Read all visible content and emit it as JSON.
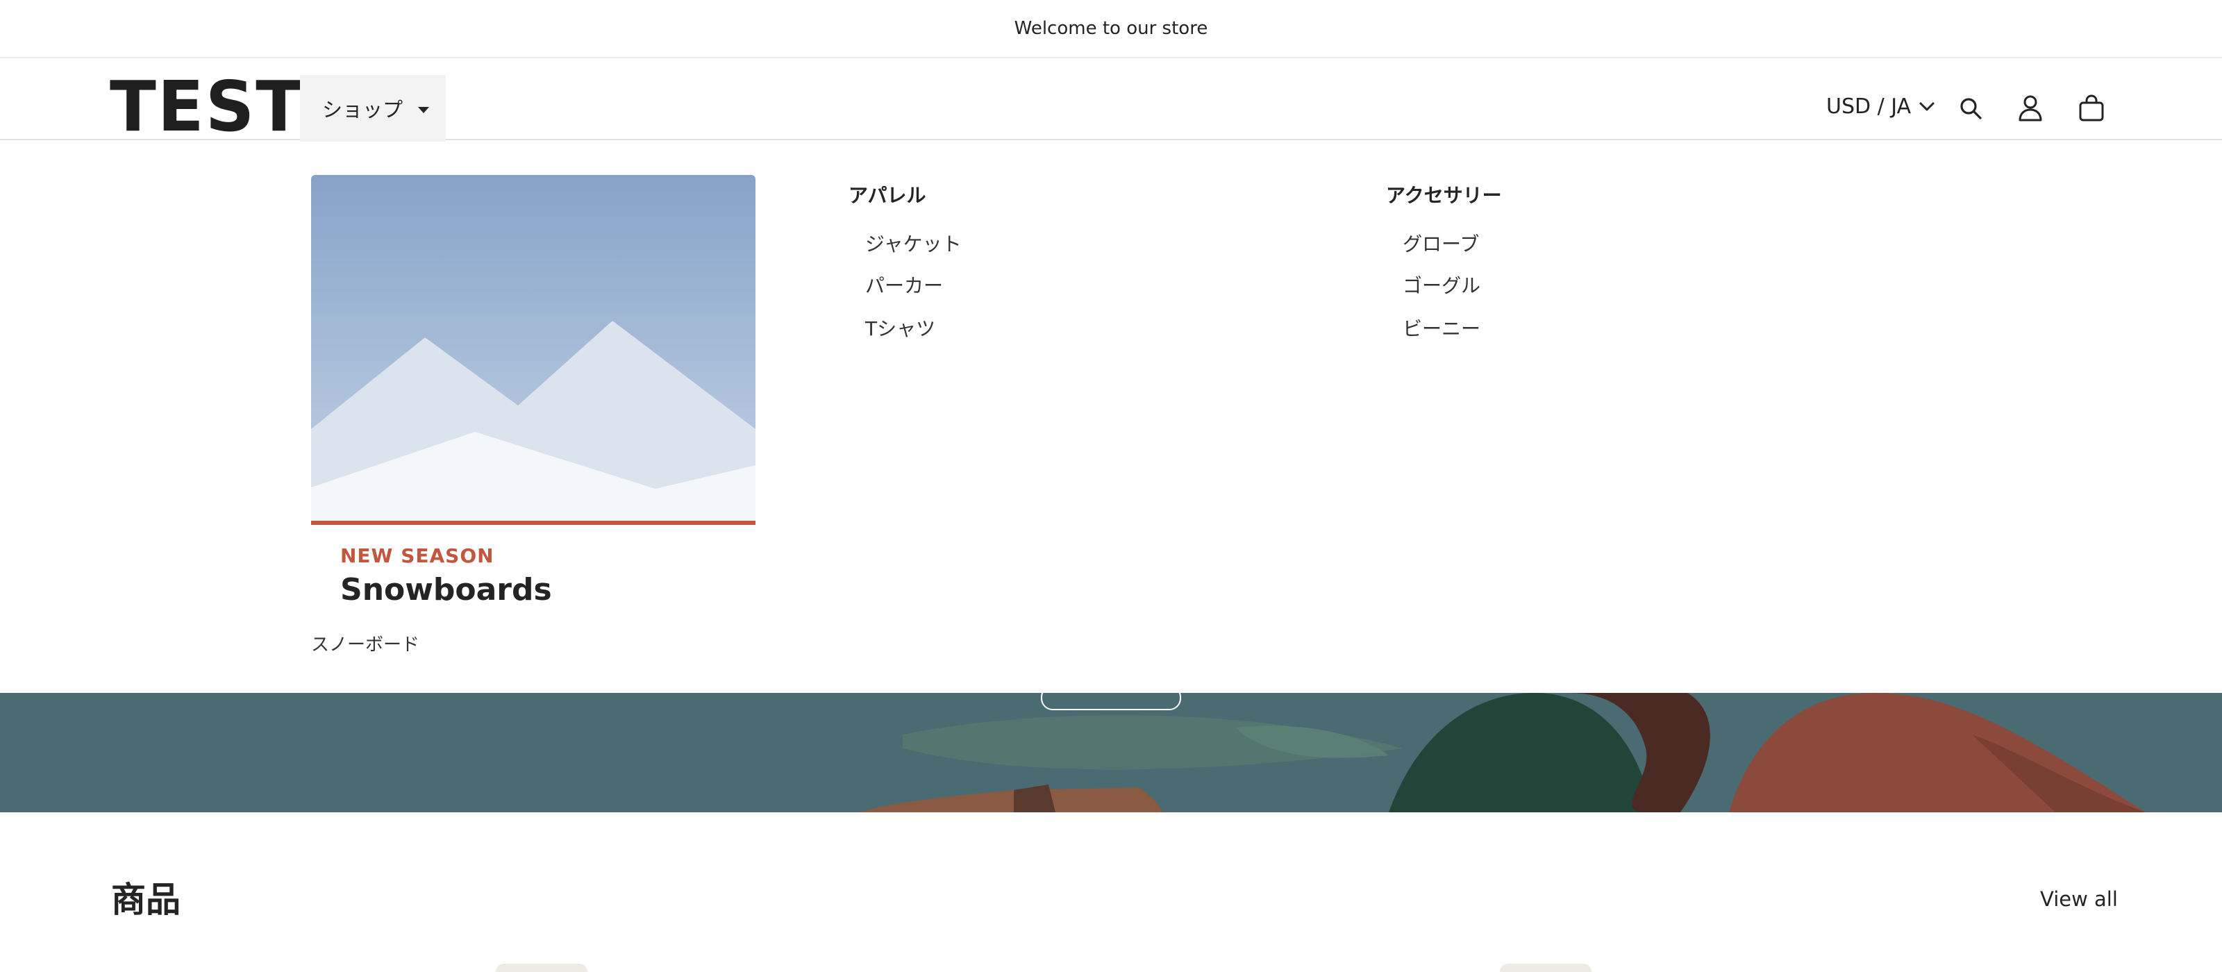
{
  "announcement": {
    "text": "Welcome to our store"
  },
  "header": {
    "logo": "TEST",
    "shop_menu_label": "ショップ",
    "currency_label": "USD / JA",
    "icons": [
      "search-icon",
      "account-icon",
      "cart-icon"
    ]
  },
  "mega_menu": {
    "feature_card": {
      "eyebrow": "NEW SEASON",
      "title": "Snowboards",
      "link": "スノーボード"
    },
    "columns": [
      {
        "heading": "アパレル",
        "items": [
          "ジャケット",
          "パーカー",
          "Tシャツ"
        ]
      },
      {
        "heading": "アクセサリー",
        "items": [
          "グローブ",
          "ゴーグル",
          "ビーニー"
        ]
      }
    ]
  },
  "products_section": {
    "title": "商品",
    "view_all": "View all"
  },
  "colors": {
    "accent": "#c2563f",
    "hero_bg": "#4a6b72",
    "text": "#242424"
  }
}
